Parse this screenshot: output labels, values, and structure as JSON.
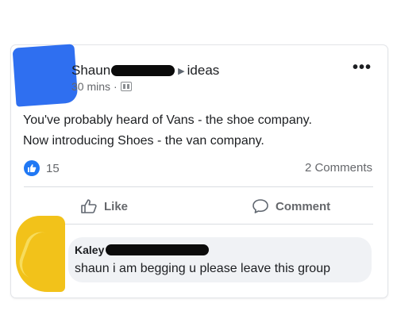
{
  "post": {
    "author": "Shaun",
    "group": "ideas",
    "time": "30 mins",
    "separator": "·",
    "more_label": "•••",
    "lines": [
      "You've probably heard of Vans - the shoe company.",
      "Now introducing Shoes - the van company."
    ],
    "reaction_count": "15",
    "comments_count": "2 Comments",
    "actions": {
      "like": "Like",
      "comment": "Comment"
    }
  },
  "comment": {
    "author": "Kaley",
    "text": "shaun i am begging u please leave this group"
  },
  "icons": {
    "avatar": "avatar",
    "privacy": "group-icon",
    "reaction": "like-thumb-icon",
    "like": "thumb-up-outline-icon",
    "comment": "speech-bubble-icon",
    "more": "more-dots-icon"
  },
  "colors": {
    "accent": "#2078f4",
    "redaction": "#0b0b0b",
    "author_avatar": "#2f6ff0",
    "commenter_avatar": "#f2c21a",
    "bubble": "#f0f2f5"
  }
}
